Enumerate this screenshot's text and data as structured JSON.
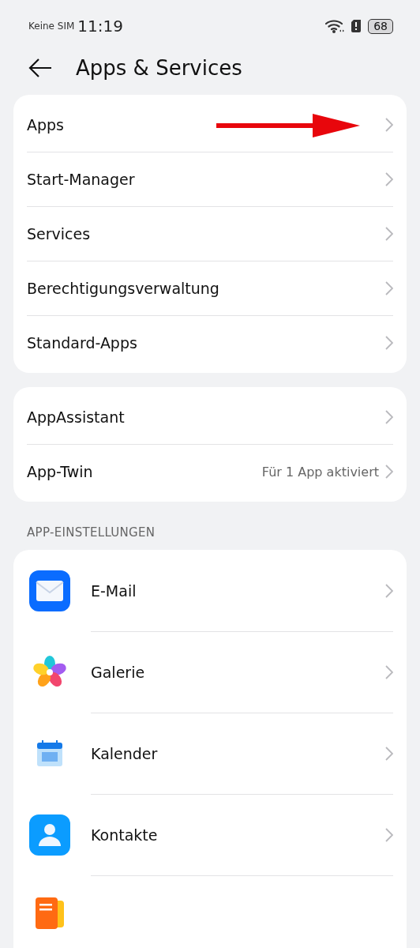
{
  "status_bar": {
    "carrier": "Keine SIM",
    "time": "11:19",
    "battery": "68"
  },
  "header": {
    "title": "Apps & Services"
  },
  "groups": [
    {
      "items": [
        {
          "label": "Apps",
          "marked": true
        },
        {
          "label": "Start-Manager",
          "marked": false
        },
        {
          "label": "Services",
          "marked": false
        },
        {
          "label": "Berechtigungsverwaltung",
          "marked": false
        },
        {
          "label": "Standard-Apps",
          "marked": false
        }
      ]
    },
    {
      "items": [
        {
          "label": "AppAssistant",
          "marked": false
        },
        {
          "label": "App-Twin",
          "value": "Für 1 App aktiviert",
          "marked": false
        }
      ]
    }
  ],
  "section": {
    "title": "APP-EINSTELLUNGEN",
    "apps": [
      {
        "label": "E-Mail",
        "kind": "mail"
      },
      {
        "label": "Galerie",
        "kind": "gallery"
      },
      {
        "label": "Kalender",
        "kind": "calendar"
      },
      {
        "label": "Kontakte",
        "kind": "contacts"
      },
      {
        "kind": "notes"
      }
    ]
  }
}
